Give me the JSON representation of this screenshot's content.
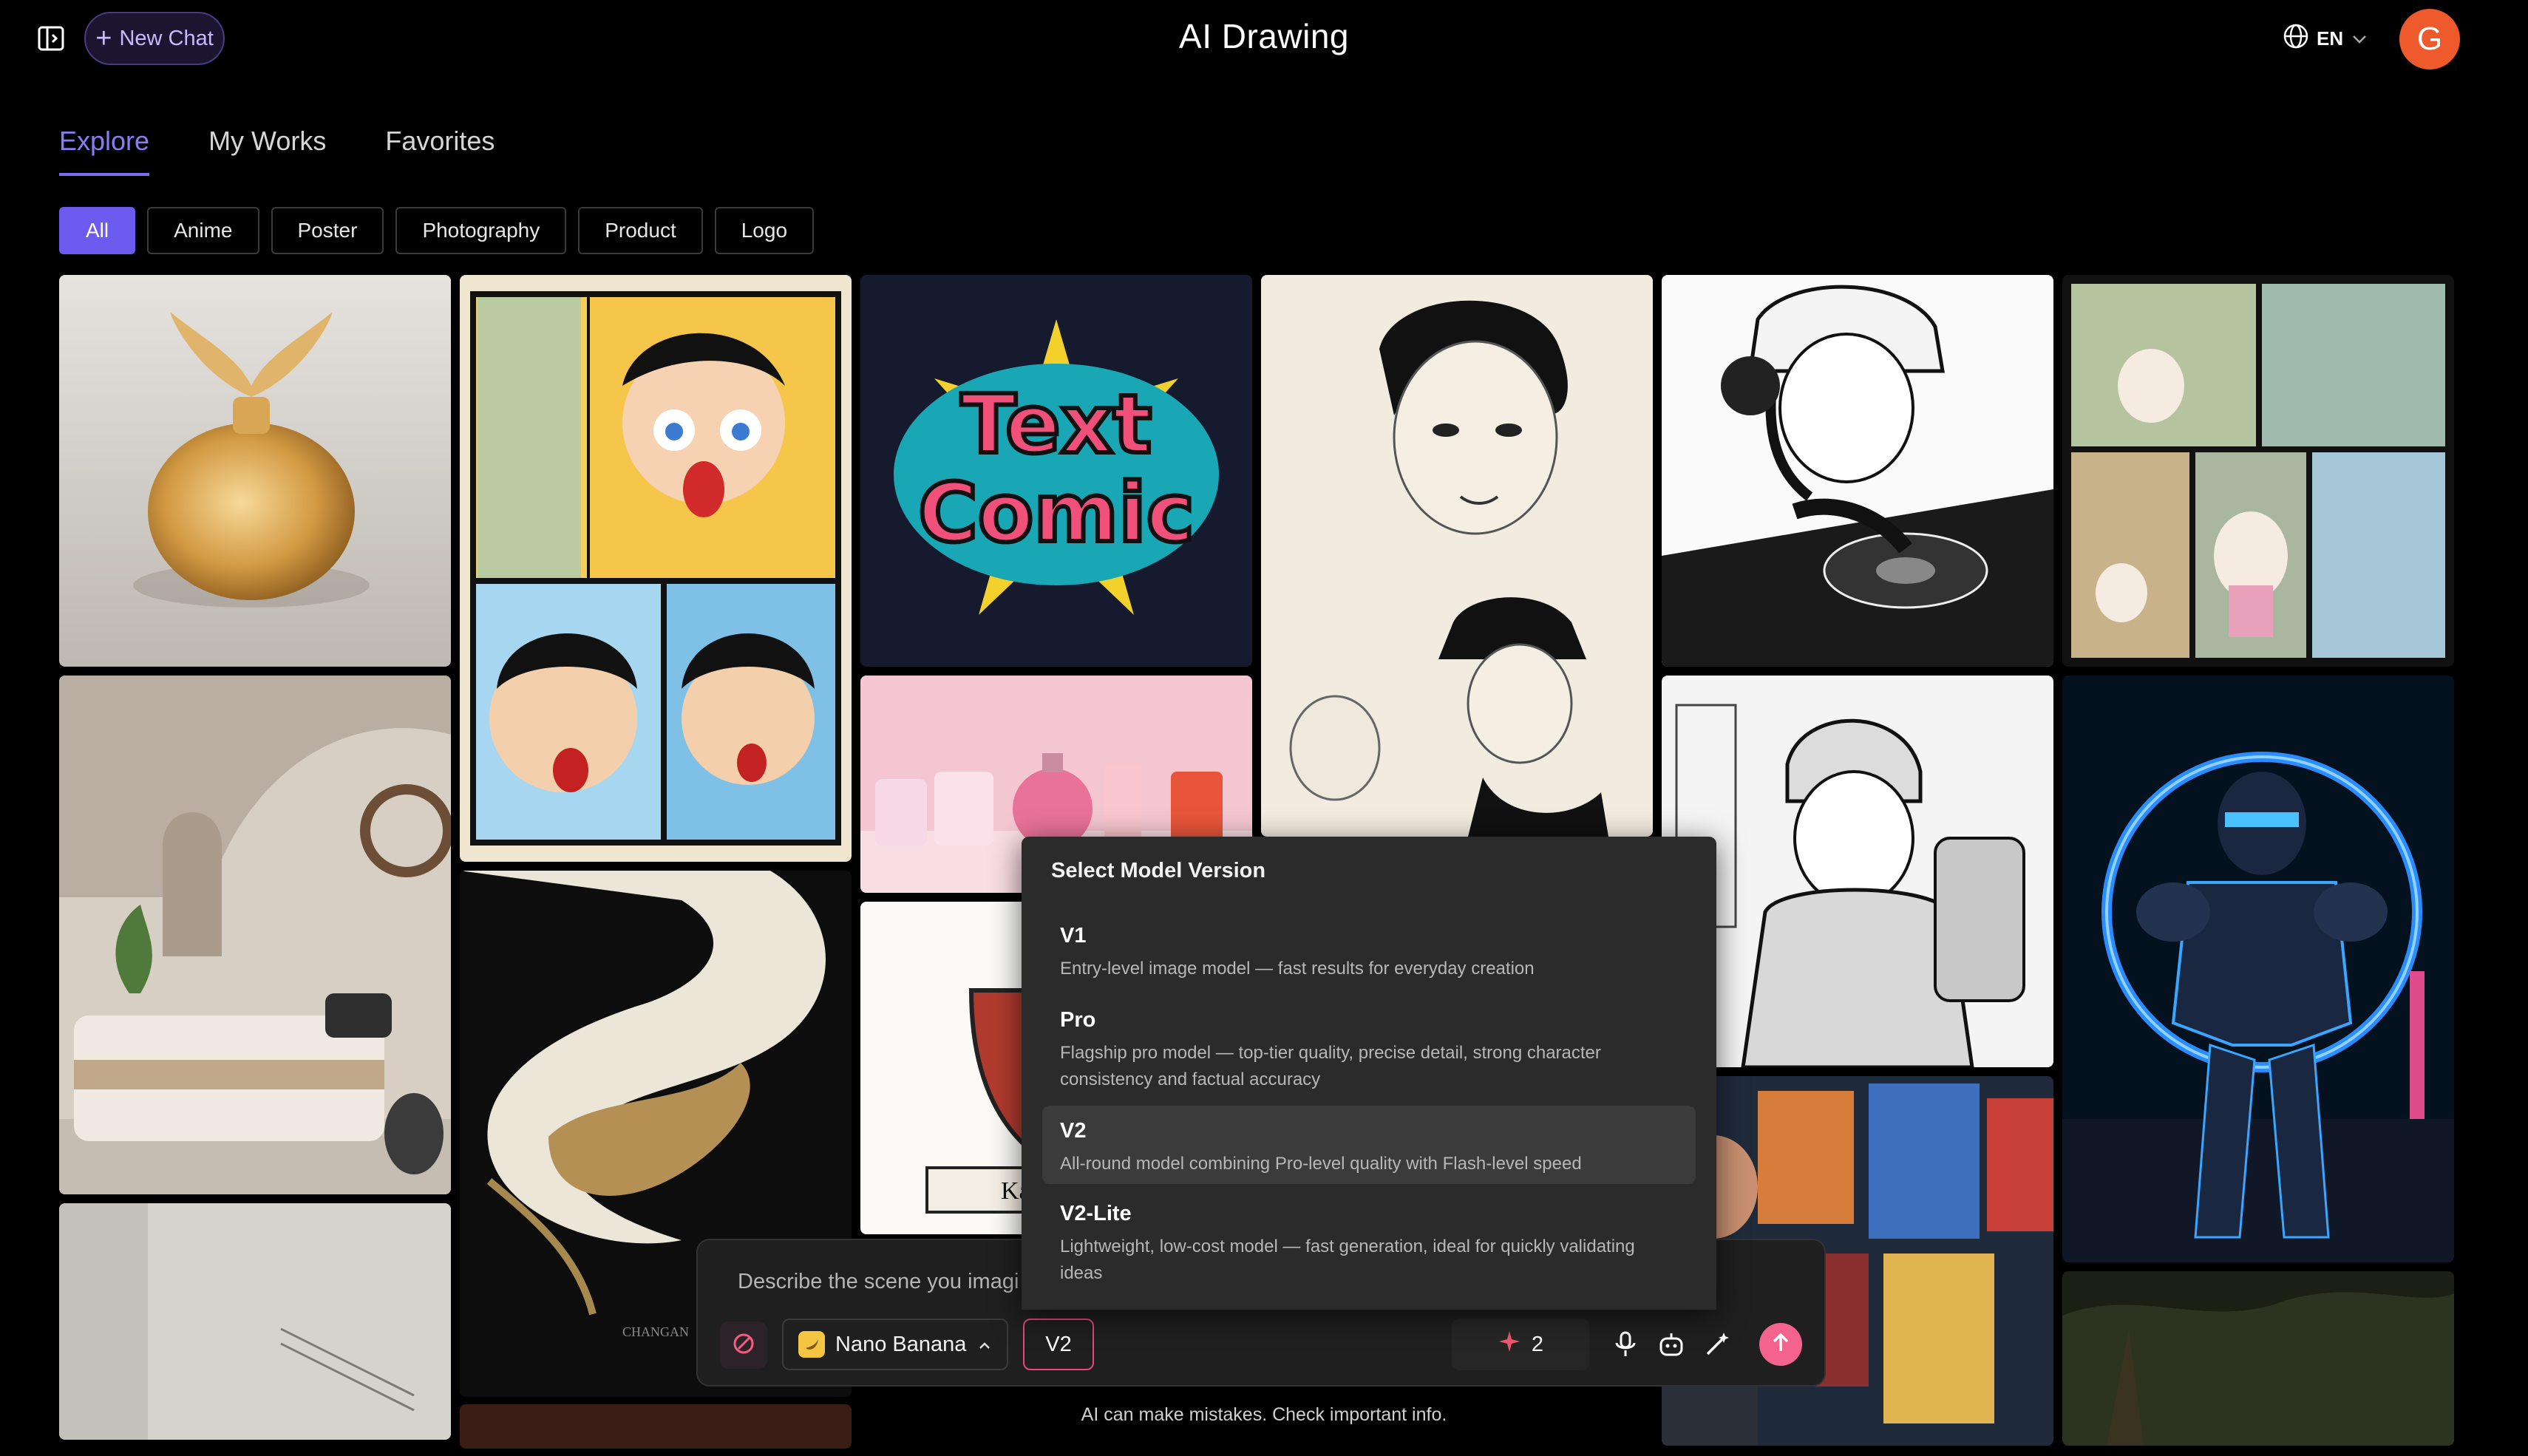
{
  "header": {
    "new_chat_label": "New Chat",
    "title": "AI Drawing",
    "language": "EN",
    "avatar_initial": "G"
  },
  "tabs": [
    {
      "label": "Explore",
      "active": true
    },
    {
      "label": "My Works",
      "active": false
    },
    {
      "label": "Favorites",
      "active": false
    }
  ],
  "filters": [
    {
      "label": "All",
      "active": true
    },
    {
      "label": "Anime",
      "active": false
    },
    {
      "label": "Poster",
      "active": false
    },
    {
      "label": "Photography",
      "active": false
    },
    {
      "label": "Product",
      "active": false
    },
    {
      "label": "Logo",
      "active": false
    }
  ],
  "gallery": {
    "comic_text_line1": "Text",
    "comic_text_line2": "Comic",
    "partial_label": "Ka",
    "poster_caption": "CHANGAN"
  },
  "model_popup": {
    "title": "Select Model Version",
    "options": [
      {
        "name": "V1",
        "description": "Entry-level image model — fast results for everyday creation",
        "selected": false
      },
      {
        "name": "Pro",
        "description": "Flagship pro model — top-tier quality, precise detail, strong character consistency and factual accuracy",
        "selected": false
      },
      {
        "name": "V2",
        "description": "All-round model combining Pro-level quality with Flash-level speed",
        "selected": true
      },
      {
        "name": "V2-Lite",
        "description": "Lightweight, low-cost model — fast generation, ideal for quickly validating ideas",
        "selected": false
      }
    ]
  },
  "composer": {
    "placeholder": "Describe the scene you imagi",
    "model_name": "Nano Banana",
    "version": "V2",
    "credits": "2"
  },
  "disclaimer": "AI can make mistakes. Check important info.",
  "colors": {
    "accent": "#6d5bf0",
    "tab_active": "#8b7cf6",
    "avatar": "#ee5a2c",
    "send": "#f4638e",
    "version_border": "#e7487a"
  }
}
